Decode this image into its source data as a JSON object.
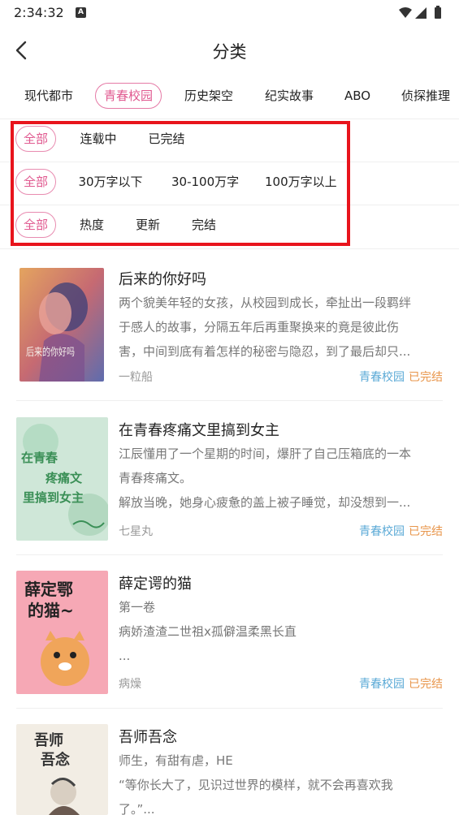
{
  "status": {
    "time": "2:34:32",
    "app_badge": "A"
  },
  "header": {
    "title": "分类"
  },
  "tabs": [
    {
      "label": "现代都市"
    },
    {
      "label": "青春校园"
    },
    {
      "label": "历史架空"
    },
    {
      "label": "纪实故事"
    },
    {
      "label": "ABO"
    },
    {
      "label": "侦探推理"
    }
  ],
  "filters": {
    "status": [
      "全部",
      "连载中",
      "已完结"
    ],
    "length": [
      "全部",
      "30万字以下",
      "30-100万字",
      "100万字以上"
    ],
    "sort": [
      "全部",
      "热度",
      "更新",
      "完结"
    ]
  },
  "books": [
    {
      "title": "后来的你好吗",
      "desc": [
        "两个貌美年轻的女孩，从校园到成长，牵扯出一段羁绊",
        "于感人的故事，分隔五年后再重聚换来的竟是彼此伤",
        "害，中间到底有着怎样的秘密与隐忍，到了最后却只..."
      ],
      "author": "一粒船",
      "category": "青春校园",
      "status": "已完结",
      "cover_text": "后来的你好吗"
    },
    {
      "title": "在青春疼痛文里搞到女主",
      "desc": [
        "江辰懂用了一个星期的时间，爆肝了自己压箱底的一本",
        "青春疼痛文。",
        "解放当晚，她身心疲惫的盖上被子睡觉，却没想到一..."
      ],
      "author": "七星丸",
      "category": "青春校园",
      "status": "已完结",
      "cover_text": "在青春疼痛文里搞到女主"
    },
    {
      "title": "薛定谔的猫",
      "desc": [
        "第一卷",
        "病娇渣渣二世祖x孤僻温柔黑长直",
        "..."
      ],
      "author": "病燥",
      "category": "青春校园",
      "status": "已完结",
      "cover_text": "薛定谔的猫~"
    },
    {
      "title": "吾师吾念",
      "desc": [
        "师生，有甜有虐，HE",
        "“等你长大了，见识过世界的模样，就不会再喜欢我",
        "了。”..."
      ],
      "author": "",
      "category": "",
      "status": "",
      "cover_text": "吾师吾念"
    }
  ],
  "colors": {
    "accent_pink": "#e0588f",
    "category_blue": "#5aa9d6",
    "status_orange": "#e8954a",
    "highlight_red": "#e8141c"
  }
}
